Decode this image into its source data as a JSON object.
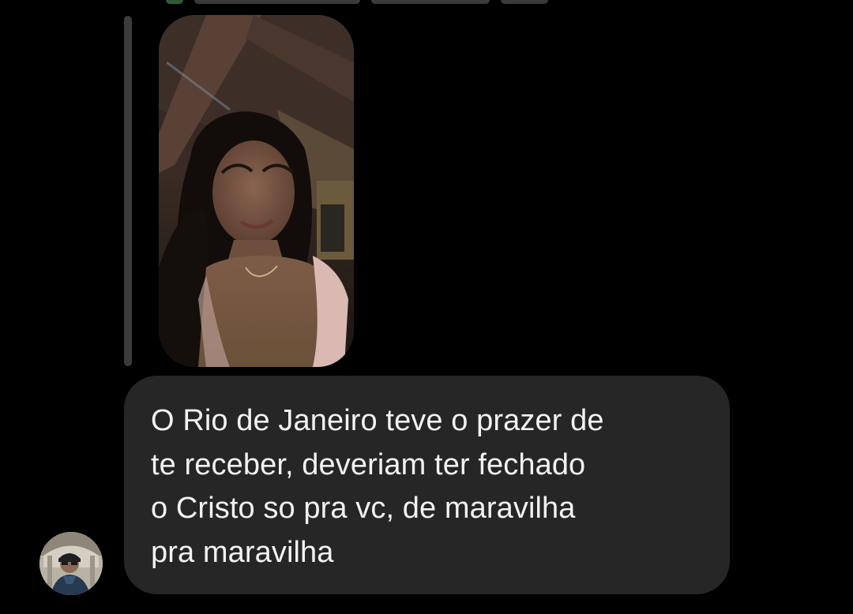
{
  "conversation": {
    "story_reply": {
      "preview_icon": "story-photo-thumbnail"
    },
    "message": {
      "text": "O Rio de Janeiro teve o prazer de\nte receber, deveriam ter fechado\no Cristo so pra vc, de maravilha\npra maravilha"
    },
    "sender": {
      "avatar_icon": "user-avatar"
    }
  },
  "colors": {
    "background": "#000000",
    "bubble": "#262626",
    "reply_bar": "#3b3b3b",
    "text": "#f2f2f2"
  }
}
